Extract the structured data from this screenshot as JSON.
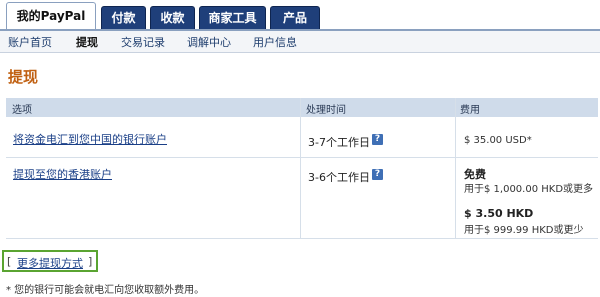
{
  "tabs": [
    {
      "label": "我的PayPal",
      "active": true
    },
    {
      "label": "付款",
      "active": false
    },
    {
      "label": "收款",
      "active": false
    },
    {
      "label": "商家工具",
      "active": false
    },
    {
      "label": "产品",
      "active": false
    }
  ],
  "subnav": [
    "账户首页",
    "提现",
    "交易记录",
    "调解中心",
    "用户信息"
  ],
  "page_title": "提现",
  "table": {
    "headers": [
      "选项",
      "处理时间",
      "费用"
    ],
    "rows": [
      {
        "option": "将资金电汇到您中国的银行账户",
        "time": "3-7个工作日",
        "fee": "$ 35.00 USD*"
      },
      {
        "option": "提现至您的香港账户",
        "time": "3-6个工作日",
        "fee_free": "免费",
        "fee_free_note": "用于$ 1,000.00 HKD或更多",
        "fee_paid": "$ 3.50 HKD",
        "fee_paid_note": "用于$ 999.99 HKD或更少"
      }
    ]
  },
  "more_link": {
    "open": "[",
    "label": "更多提现方式",
    "close": "]"
  },
  "footnote": "* 您的银行可能会就电汇向您收取额外费用。",
  "colors": {
    "tab_bg": "#1f3f7a",
    "title": "#c06012",
    "header_bg": "#cfdbea",
    "highlight_border": "#5aa431",
    "link": "#1a3f87"
  }
}
